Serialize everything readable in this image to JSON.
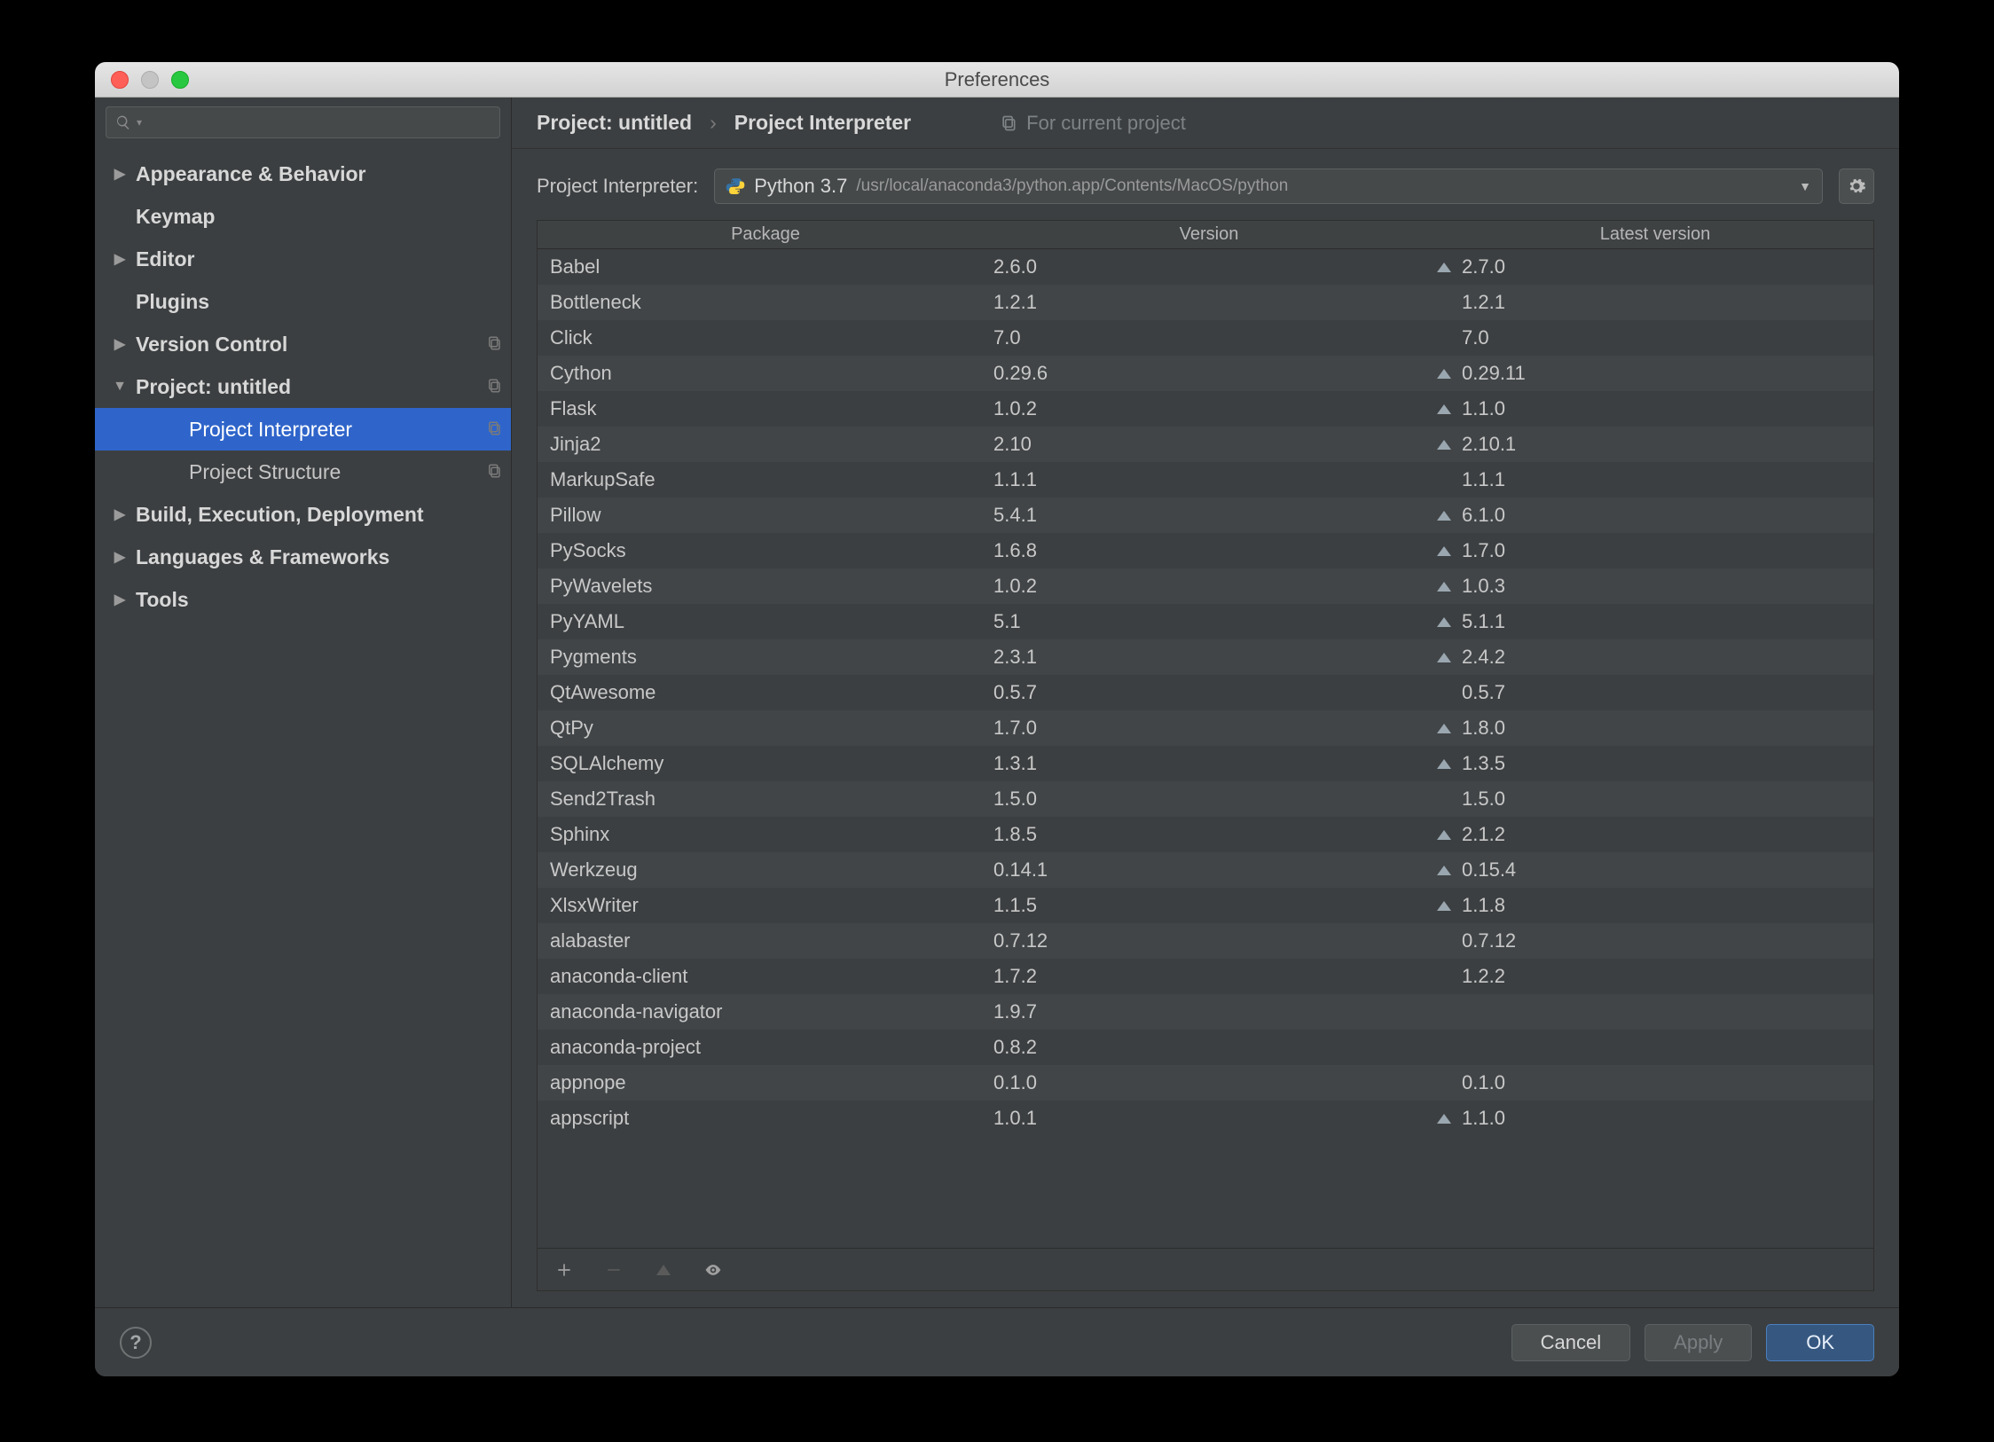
{
  "window": {
    "title": "Preferences"
  },
  "search": {
    "placeholder": ""
  },
  "sidebar": {
    "items": [
      {
        "label": "Appearance & Behavior",
        "arrow": "right",
        "bold": true
      },
      {
        "label": "Keymap",
        "arrow": "",
        "bold": true
      },
      {
        "label": "Editor",
        "arrow": "right",
        "bold": true
      },
      {
        "label": "Plugins",
        "arrow": "",
        "bold": true
      },
      {
        "label": "Version Control",
        "arrow": "right",
        "bold": true,
        "trail": true
      },
      {
        "label": "Project: untitled",
        "arrow": "down",
        "bold": true,
        "trail": true
      },
      {
        "label": "Project Interpreter",
        "arrow": "",
        "bold": false,
        "indent": 2,
        "selected": true,
        "trail": true
      },
      {
        "label": "Project Structure",
        "arrow": "",
        "bold": false,
        "indent": 2,
        "trail": true
      },
      {
        "label": "Build, Execution, Deployment",
        "arrow": "right",
        "bold": true
      },
      {
        "label": "Languages & Frameworks",
        "arrow": "right",
        "bold": true
      },
      {
        "label": "Tools",
        "arrow": "right",
        "bold": true
      }
    ]
  },
  "breadcrumb": {
    "project": "Project: untitled",
    "sep": "›",
    "page": "Project Interpreter",
    "hint": "For current project"
  },
  "interpreter": {
    "label": "Project Interpreter:",
    "version": "Python 3.7",
    "path": "/usr/local/anaconda3/python.app/Contents/MacOS/python"
  },
  "table": {
    "headers": {
      "package": "Package",
      "version": "Version",
      "latest": "Latest version"
    },
    "rows": [
      {
        "pkg": "Babel",
        "ver": "2.6.0",
        "lat": "2.7.0",
        "up": true
      },
      {
        "pkg": "Bottleneck",
        "ver": "1.2.1",
        "lat": "1.2.1",
        "up": false
      },
      {
        "pkg": "Click",
        "ver": "7.0",
        "lat": "7.0",
        "up": false
      },
      {
        "pkg": "Cython",
        "ver": "0.29.6",
        "lat": "0.29.11",
        "up": true
      },
      {
        "pkg": "Flask",
        "ver": "1.0.2",
        "lat": "1.1.0",
        "up": true
      },
      {
        "pkg": "Jinja2",
        "ver": "2.10",
        "lat": "2.10.1",
        "up": true
      },
      {
        "pkg": "MarkupSafe",
        "ver": "1.1.1",
        "lat": "1.1.1",
        "up": false
      },
      {
        "pkg": "Pillow",
        "ver": "5.4.1",
        "lat": "6.1.0",
        "up": true
      },
      {
        "pkg": "PySocks",
        "ver": "1.6.8",
        "lat": "1.7.0",
        "up": true
      },
      {
        "pkg": "PyWavelets",
        "ver": "1.0.2",
        "lat": "1.0.3",
        "up": true
      },
      {
        "pkg": "PyYAML",
        "ver": "5.1",
        "lat": "5.1.1",
        "up": true
      },
      {
        "pkg": "Pygments",
        "ver": "2.3.1",
        "lat": "2.4.2",
        "up": true
      },
      {
        "pkg": "QtAwesome",
        "ver": "0.5.7",
        "lat": "0.5.7",
        "up": false
      },
      {
        "pkg": "QtPy",
        "ver": "1.7.0",
        "lat": "1.8.0",
        "up": true
      },
      {
        "pkg": "SQLAlchemy",
        "ver": "1.3.1",
        "lat": "1.3.5",
        "up": true
      },
      {
        "pkg": "Send2Trash",
        "ver": "1.5.0",
        "lat": "1.5.0",
        "up": false
      },
      {
        "pkg": "Sphinx",
        "ver": "1.8.5",
        "lat": "2.1.2",
        "up": true
      },
      {
        "pkg": "Werkzeug",
        "ver": "0.14.1",
        "lat": "0.15.4",
        "up": true
      },
      {
        "pkg": "XlsxWriter",
        "ver": "1.1.5",
        "lat": "1.1.8",
        "up": true
      },
      {
        "pkg": "alabaster",
        "ver": "0.7.12",
        "lat": "0.7.12",
        "up": false
      },
      {
        "pkg": "anaconda-client",
        "ver": "1.7.2",
        "lat": "1.2.2",
        "up": false
      },
      {
        "pkg": "anaconda-navigator",
        "ver": "1.9.7",
        "lat": "",
        "up": false
      },
      {
        "pkg": "anaconda-project",
        "ver": "0.8.2",
        "lat": "",
        "up": false
      },
      {
        "pkg": "appnope",
        "ver": "0.1.0",
        "lat": "0.1.0",
        "up": false
      },
      {
        "pkg": "appscript",
        "ver": "1.0.1",
        "lat": "1.1.0",
        "up": true
      }
    ]
  },
  "buttons": {
    "cancel": "Cancel",
    "apply": "Apply",
    "ok": "OK",
    "help": "?"
  }
}
